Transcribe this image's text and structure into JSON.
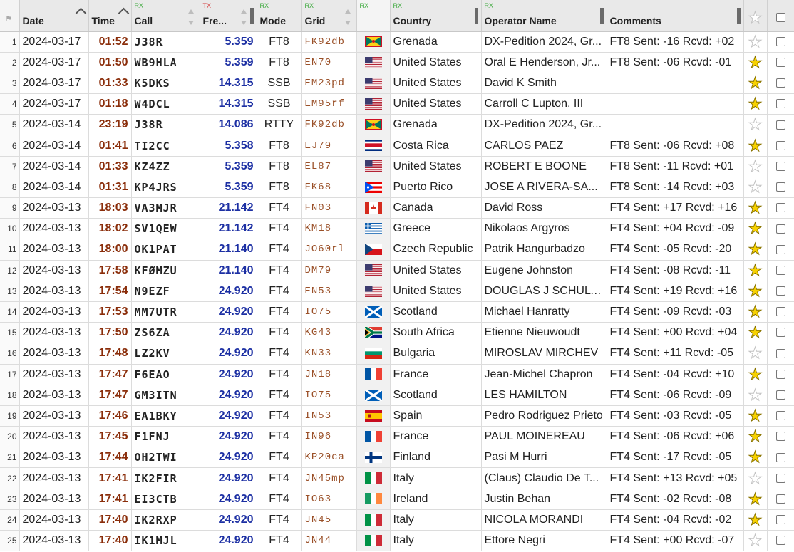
{
  "columns": {
    "date": "Date",
    "time": "Time",
    "call": "Call",
    "call_tag": "RX",
    "freq": "Fre...",
    "freq_tag": "TX",
    "mode": "Mode",
    "mode_tag": "RX",
    "grid": "Grid",
    "grid_tag": "RX",
    "flag_tag": "RX",
    "country": "Country",
    "country_tag": "RX",
    "operator": "Operator Name",
    "operator_tag": "RX",
    "comments": "Comments"
  },
  "rows": [
    {
      "n": "1",
      "date": "2024-03-17",
      "time": "01:52",
      "call": "J38R",
      "freq": "5.359",
      "mode": "FT8",
      "grid": "FK92db",
      "flag": "grenada",
      "country": "Grenada",
      "op": "DX-Pedition 2024, Gr...",
      "comm": "FT8 Sent: -16 Rcvd: +02",
      "star": false
    },
    {
      "n": "2",
      "date": "2024-03-17",
      "time": "01:50",
      "call": "WB9HLA",
      "freq": "5.359",
      "mode": "FT8",
      "grid": "EN70",
      "flag": "usa",
      "country": "United States",
      "op": "Oral E Henderson, Jr...",
      "comm": "FT8 Sent: -06 Rcvd: -01",
      "star": true
    },
    {
      "n": "3",
      "date": "2024-03-17",
      "time": "01:33",
      "call": "K5DKS",
      "freq": "14.315",
      "mode": "SSB",
      "grid": "EM23pd",
      "flag": "usa",
      "country": "United States",
      "op": "David K Smith",
      "comm": "",
      "star": true
    },
    {
      "n": "4",
      "date": "2024-03-17",
      "time": "01:18",
      "call": "W4DCL",
      "freq": "14.315",
      "mode": "SSB",
      "grid": "EM95rf",
      "flag": "usa",
      "country": "United States",
      "op": "Carroll C Lupton, III",
      "comm": "",
      "star": true
    },
    {
      "n": "5",
      "date": "2024-03-14",
      "time": "23:19",
      "call": "J38R",
      "freq": "14.086",
      "mode": "RTTY",
      "grid": "FK92db",
      "flag": "grenada",
      "country": "Grenada",
      "op": "DX-Pedition 2024, Gr...",
      "comm": "",
      "star": false
    },
    {
      "n": "6",
      "date": "2024-03-14",
      "time": "01:41",
      "call": "TI2CC",
      "freq": "5.358",
      "mode": "FT8",
      "grid": "EJ79",
      "flag": "costarica",
      "country": "Costa Rica",
      "op": "CARLOS PAEZ",
      "comm": "FT8 Sent: -06 Rcvd: +08",
      "star": true
    },
    {
      "n": "7",
      "date": "2024-03-14",
      "time": "01:33",
      "call": "KZ4ZZ",
      "freq": "5.359",
      "mode": "FT8",
      "grid": "EL87",
      "flag": "usa",
      "country": "United States",
      "op": "ROBERT E BOONE",
      "comm": "FT8 Sent: -11 Rcvd: +01",
      "star": false
    },
    {
      "n": "8",
      "date": "2024-03-14",
      "time": "01:31",
      "call": "KP4JRS",
      "freq": "5.359",
      "mode": "FT8",
      "grid": "FK68",
      "flag": "puertorico",
      "country": "Puerto Rico",
      "op": "JOSE A RIVERA-SA...",
      "comm": "FT8 Sent: -14 Rcvd: +03",
      "star": false
    },
    {
      "n": "9",
      "date": "2024-03-13",
      "time": "18:03",
      "call": "VA3MJR",
      "freq": "21.142",
      "mode": "FT4",
      "grid": "FN03",
      "flag": "canada",
      "country": "Canada",
      "op": "David Ross",
      "comm": "FT4 Sent: +17 Rcvd: +16",
      "star": true
    },
    {
      "n": "10",
      "date": "2024-03-13",
      "time": "18:02",
      "call": "SV1QEW",
      "freq": "21.142",
      "mode": "FT4",
      "grid": "KM18",
      "flag": "greece",
      "country": "Greece",
      "op": "Nikolaos Argyros",
      "comm": "FT4 Sent: +04 Rcvd: -09",
      "star": true
    },
    {
      "n": "11",
      "date": "2024-03-13",
      "time": "18:00",
      "call": "OK1PAT",
      "freq": "21.140",
      "mode": "FT4",
      "grid": "JO60rl",
      "flag": "czech",
      "country": "Czech Republic",
      "op": "Patrik Hangurbadzo",
      "comm": "FT4 Sent: -05 Rcvd: -20",
      "star": true
    },
    {
      "n": "12",
      "date": "2024-03-13",
      "time": "17:58",
      "call": "KFØMZU",
      "freq": "21.140",
      "mode": "FT4",
      "grid": "DM79",
      "flag": "usa",
      "country": "United States",
      "op": "Eugene Johnston",
      "comm": "FT4 Sent: -08 Rcvd: -11",
      "star": true
    },
    {
      "n": "13",
      "date": "2024-03-13",
      "time": "17:54",
      "call": "N9EZF",
      "freq": "24.920",
      "mode": "FT4",
      "grid": "EN53",
      "flag": "usa",
      "country": "United States",
      "op": "DOUGLAS J SCHULTZ",
      "comm": "FT4 Sent: +19 Rcvd: +16",
      "star": true
    },
    {
      "n": "14",
      "date": "2024-03-13",
      "time": "17:53",
      "call": "MM7UTR",
      "freq": "24.920",
      "mode": "FT4",
      "grid": "IO75",
      "flag": "scotland",
      "country": "Scotland",
      "op": "Michael Hanratty",
      "comm": "FT4 Sent: -09 Rcvd: -03",
      "star": true
    },
    {
      "n": "15",
      "date": "2024-03-13",
      "time": "17:50",
      "call": "ZS6ZA",
      "freq": "24.920",
      "mode": "FT4",
      "grid": "KG43",
      "flag": "southafrica",
      "country": "South Africa",
      "op": "Etienne Nieuwoudt",
      "comm": "FT4 Sent: +00 Rcvd: +04",
      "star": true
    },
    {
      "n": "16",
      "date": "2024-03-13",
      "time": "17:48",
      "call": "LZ2KV",
      "freq": "24.920",
      "mode": "FT4",
      "grid": "KN33",
      "flag": "bulgaria",
      "country": "Bulgaria",
      "op": "MIROSLAV MIRCHEV",
      "comm": "FT4 Sent: +11 Rcvd: -05",
      "star": false
    },
    {
      "n": "17",
      "date": "2024-03-13",
      "time": "17:47",
      "call": "F6EAO",
      "freq": "24.920",
      "mode": "FT4",
      "grid": "JN18",
      "flag": "france",
      "country": "France",
      "op": "Jean-Michel Chapron",
      "comm": "FT4 Sent: -04 Rcvd: +10",
      "star": true
    },
    {
      "n": "18",
      "date": "2024-03-13",
      "time": "17:47",
      "call": "GM3ITN",
      "freq": "24.920",
      "mode": "FT4",
      "grid": "IO75",
      "flag": "scotland",
      "country": "Scotland",
      "op": "LES HAMILTON",
      "comm": "FT4 Sent: -06 Rcvd: -09",
      "star": false
    },
    {
      "n": "19",
      "date": "2024-03-13",
      "time": "17:46",
      "call": "EA1BKY",
      "freq": "24.920",
      "mode": "FT4",
      "grid": "IN53",
      "flag": "spain",
      "country": "Spain",
      "op": "Pedro Rodriguez Prieto",
      "comm": "FT4 Sent: -03 Rcvd: -05",
      "star": true
    },
    {
      "n": "20",
      "date": "2024-03-13",
      "time": "17:45",
      "call": "F1FNJ",
      "freq": "24.920",
      "mode": "FT4",
      "grid": "IN96",
      "flag": "france",
      "country": "France",
      "op": "PAUL MOINEREAU",
      "comm": "FT4 Sent: -06 Rcvd: +06",
      "star": true
    },
    {
      "n": "21",
      "date": "2024-03-13",
      "time": "17:44",
      "call": "OH2TWI",
      "freq": "24.920",
      "mode": "FT4",
      "grid": "KP20ca",
      "flag": "finland",
      "country": "Finland",
      "op": "Pasi M Hurri",
      "comm": "FT4 Sent: -17 Rcvd: -05",
      "star": true
    },
    {
      "n": "22",
      "date": "2024-03-13",
      "time": "17:41",
      "call": "IK2FIR",
      "freq": "24.920",
      "mode": "FT4",
      "grid": "JN45mp",
      "flag": "italy",
      "country": "Italy",
      "op": "(Claus) Claudio De T...",
      "comm": "FT4 Sent: +13 Rcvd: +05",
      "star": false
    },
    {
      "n": "23",
      "date": "2024-03-13",
      "time": "17:41",
      "call": "EI3CTB",
      "freq": "24.920",
      "mode": "FT4",
      "grid": "IO63",
      "flag": "ireland",
      "country": "Ireland",
      "op": "Justin Behan",
      "comm": "FT4 Sent: -02 Rcvd: -08",
      "star": true
    },
    {
      "n": "24",
      "date": "2024-03-13",
      "time": "17:40",
      "call": "IK2RXP",
      "freq": "24.920",
      "mode": "FT4",
      "grid": "JN45",
      "flag": "italy",
      "country": "Italy",
      "op": "NICOLA MORANDI",
      "comm": "FT4 Sent: -04 Rcvd: -02",
      "star": true
    },
    {
      "n": "25",
      "date": "2024-03-13",
      "time": "17:40",
      "call": "IK1MJL",
      "freq": "24.920",
      "mode": "FT4",
      "grid": "JN44",
      "flag": "italy",
      "country": "Italy",
      "op": "Ettore Negri",
      "comm": "FT4 Sent: +00 Rcvd: -07",
      "star": false
    }
  ],
  "colors": {
    "time": "#8a2d0a",
    "freq": "#1c2fa3",
    "grid": "#9a5028",
    "star_on": "#f7d100",
    "rx_tag": "#3aa83a",
    "tx_tag": "#d43c3c"
  }
}
